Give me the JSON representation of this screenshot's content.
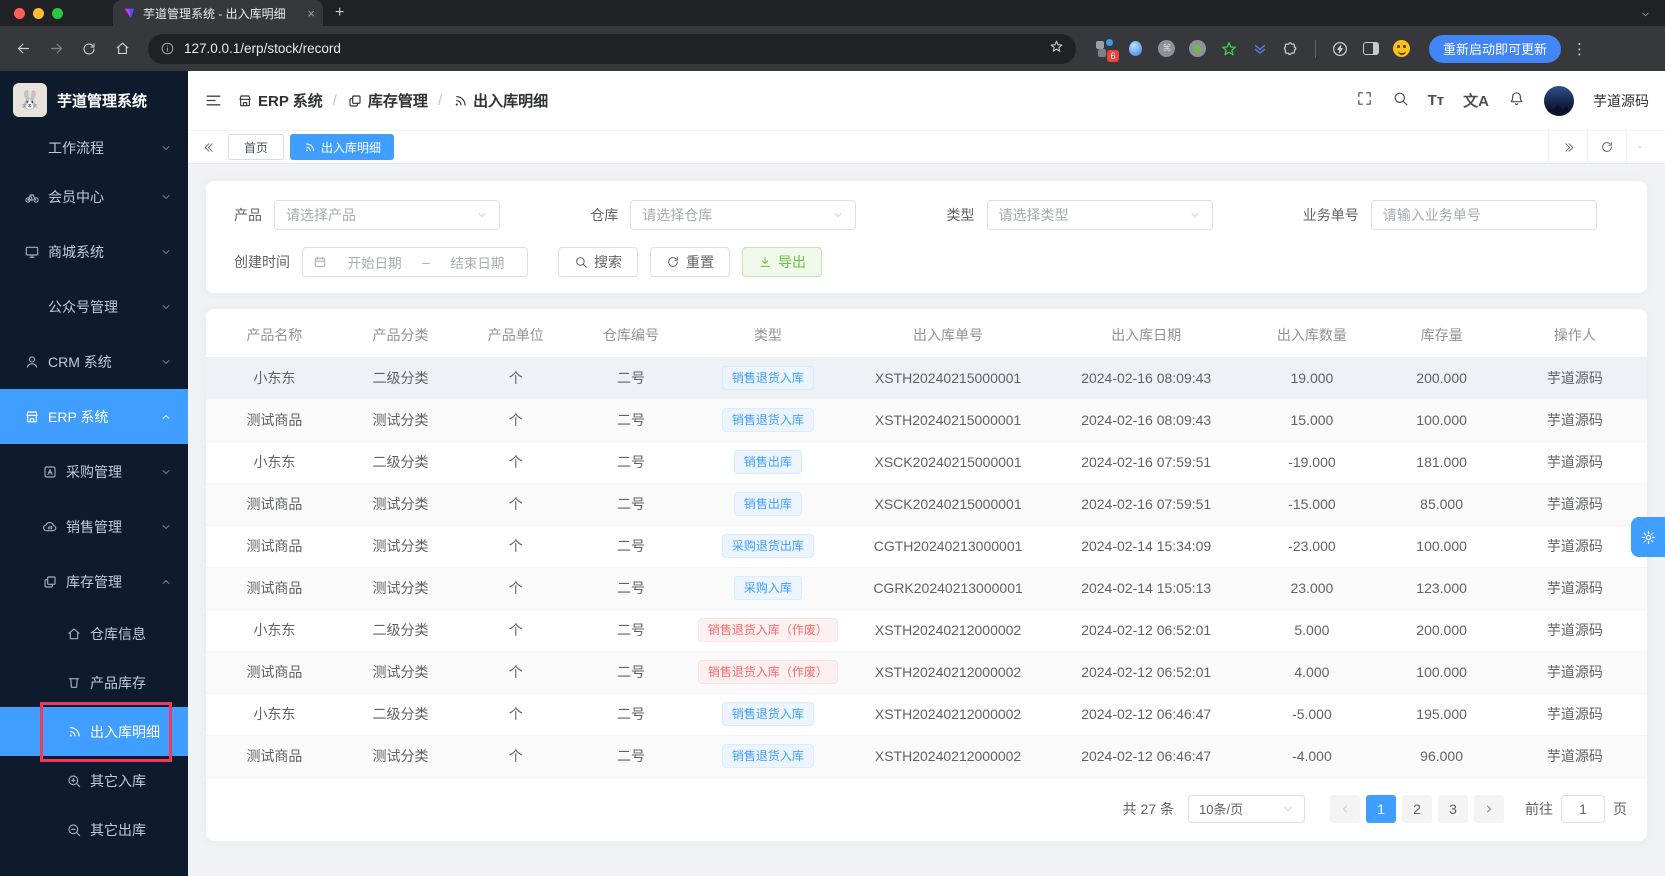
{
  "browser": {
    "tab_title": "芋道管理系统 - 出入库明细",
    "url": "127.0.0.1/erp/stock/record",
    "ext_badge": "6",
    "update_button": "重新启动即可更新"
  },
  "sidebar": {
    "title": "芋道管理系统",
    "items": [
      {
        "label": "工作流程"
      },
      {
        "label": "会员中心"
      },
      {
        "label": "商城系统"
      },
      {
        "label": "公众号管理"
      },
      {
        "label": "CRM 系统"
      },
      {
        "label": "ERP 系统"
      },
      {
        "label": "采购管理"
      },
      {
        "label": "销售管理"
      },
      {
        "label": "库存管理"
      },
      {
        "label": "仓库信息"
      },
      {
        "label": "产品库存"
      },
      {
        "label": "出入库明细"
      },
      {
        "label": "其它入库"
      },
      {
        "label": "其它出库"
      }
    ]
  },
  "header": {
    "breadcrumb": {
      "0": "ERP 系统",
      "1": "库存管理",
      "2": "出入库明细"
    },
    "font_icon_label": "Tт",
    "lang_icon_label": "文A",
    "username": "芋道源码"
  },
  "tabs": {
    "home": "首页",
    "active": "出入库明细"
  },
  "filters": {
    "product_label": "产品",
    "product_placeholder": "请选择产品",
    "warehouse_label": "仓库",
    "warehouse_placeholder": "请选择仓库",
    "type_label": "类型",
    "type_placeholder": "请选择类型",
    "bizno_label": "业务单号",
    "bizno_placeholder": "请输入业务单号",
    "date_label": "创建时间",
    "date_start_placeholder": "开始日期",
    "date_separator": "–",
    "date_end_placeholder": "结束日期",
    "search_label": "搜索",
    "reset_label": "重置",
    "export_label": "导出"
  },
  "table": {
    "columns": [
      "产品名称",
      "产品分类",
      "产品单位",
      "仓库编号",
      "类型",
      "出入库单号",
      "出入库日期",
      "出入库数量",
      "库存量",
      "操作人"
    ],
    "rows": [
      {
        "product": "小东东",
        "category": "二级分类",
        "unit": "个",
        "warehouse": "二号",
        "type": "销售退货入库",
        "type_color": "blue",
        "order": "XSTH20240215000001",
        "date": "2024-02-16 08:09:43",
        "qty": "19.000",
        "stock": "200.000",
        "operator": "芋道源码"
      },
      {
        "product": "测试商品",
        "category": "测试分类",
        "unit": "个",
        "warehouse": "二号",
        "type": "销售退货入库",
        "type_color": "blue",
        "order": "XSTH20240215000001",
        "date": "2024-02-16 08:09:43",
        "qty": "15.000",
        "stock": "100.000",
        "operator": "芋道源码"
      },
      {
        "product": "小东东",
        "category": "二级分类",
        "unit": "个",
        "warehouse": "二号",
        "type": "销售出库",
        "type_color": "blue",
        "order": "XSCK20240215000001",
        "date": "2024-02-16 07:59:51",
        "qty": "-19.000",
        "stock": "181.000",
        "operator": "芋道源码"
      },
      {
        "product": "测试商品",
        "category": "测试分类",
        "unit": "个",
        "warehouse": "二号",
        "type": "销售出库",
        "type_color": "blue",
        "order": "XSCK20240215000001",
        "date": "2024-02-16 07:59:51",
        "qty": "-15.000",
        "stock": "85.000",
        "operator": "芋道源码"
      },
      {
        "product": "测试商品",
        "category": "测试分类",
        "unit": "个",
        "warehouse": "二号",
        "type": "采购退货出库",
        "type_color": "blue",
        "order": "CGTH20240213000001",
        "date": "2024-02-14 15:34:09",
        "qty": "-23.000",
        "stock": "100.000",
        "operator": "芋道源码"
      },
      {
        "product": "测试商品",
        "category": "测试分类",
        "unit": "个",
        "warehouse": "二号",
        "type": "采购入库",
        "type_color": "blue",
        "order": "CGRK20240213000001",
        "date": "2024-02-14 15:05:13",
        "qty": "23.000",
        "stock": "123.000",
        "operator": "芋道源码"
      },
      {
        "product": "小东东",
        "category": "二级分类",
        "unit": "个",
        "warehouse": "二号",
        "type": "销售退货入库（作废）",
        "type_color": "red",
        "order": "XSTH20240212000002",
        "date": "2024-02-12 06:52:01",
        "qty": "5.000",
        "stock": "200.000",
        "operator": "芋道源码"
      },
      {
        "product": "测试商品",
        "category": "测试分类",
        "unit": "个",
        "warehouse": "二号",
        "type": "销售退货入库（作废）",
        "type_color": "red",
        "order": "XSTH20240212000002",
        "date": "2024-02-12 06:52:01",
        "qty": "4.000",
        "stock": "100.000",
        "operator": "芋道源码"
      },
      {
        "product": "小东东",
        "category": "二级分类",
        "unit": "个",
        "warehouse": "二号",
        "type": "销售退货入库",
        "type_color": "blue",
        "order": "XSTH20240212000002",
        "date": "2024-02-12 06:46:47",
        "qty": "-5.000",
        "stock": "195.000",
        "operator": "芋道源码"
      },
      {
        "product": "测试商品",
        "category": "测试分类",
        "unit": "个",
        "warehouse": "二号",
        "type": "销售退货入库",
        "type_color": "blue",
        "order": "XSTH20240212000002",
        "date": "2024-02-12 06:46:47",
        "qty": "-4.000",
        "stock": "96.000",
        "operator": "芋道源码"
      }
    ]
  },
  "pagination": {
    "total": "共 27 条",
    "page_size": "10条/页",
    "pages": [
      "1",
      "2",
      "3"
    ],
    "active_page": "1",
    "goto_label": "前往",
    "goto_value": "1",
    "page_unit": "页"
  }
}
